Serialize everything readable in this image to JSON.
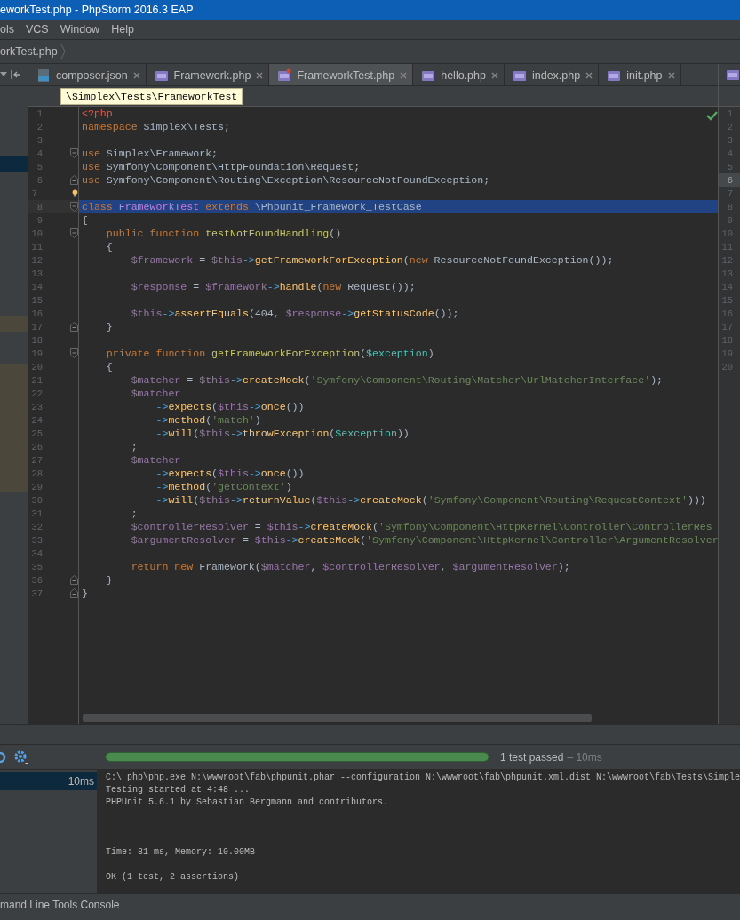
{
  "window": {
    "title": "eworkTest.php - PhpStorm 2016.3 EAP"
  },
  "menu": [
    "ols",
    "VCS",
    "Window",
    "Help"
  ],
  "breadcrumb": "orkTest.php",
  "project_panel": {
    "rows": [
      {
        "kind": "plain"
      },
      {
        "kind": "plain"
      },
      {
        "kind": "plain"
      },
      {
        "kind": "plain"
      },
      {
        "kind": "selected"
      },
      {
        "kind": "plain"
      },
      {
        "kind": "plain"
      },
      {
        "kind": "plain"
      },
      {
        "kind": "plain"
      },
      {
        "kind": "plain"
      },
      {
        "kind": "plain"
      },
      {
        "kind": "plain"
      },
      {
        "kind": "plain"
      },
      {
        "kind": "plain"
      },
      {
        "kind": "modified"
      },
      {
        "kind": "plain"
      },
      {
        "kind": "plain"
      },
      {
        "kind": "modified"
      },
      {
        "kind": "modified"
      },
      {
        "kind": "modified"
      },
      {
        "kind": "modified"
      },
      {
        "kind": "modified"
      },
      {
        "kind": "modified"
      },
      {
        "kind": "modified"
      },
      {
        "kind": "modified"
      }
    ]
  },
  "tabs": [
    {
      "label": "composer.json",
      "kind": "json",
      "selected": false
    },
    {
      "label": "Framework.php",
      "kind": "php",
      "selected": false
    },
    {
      "label": "FrameworkTest.php",
      "kind": "phptest",
      "selected": true
    },
    {
      "label": "hello.php",
      "kind": "php",
      "selected": false
    },
    {
      "label": "index.php",
      "kind": "php",
      "selected": false
    },
    {
      "label": "init.php",
      "kind": "php",
      "selected": false
    }
  ],
  "tooltip": "\\Simplex\\Tests\\FrameworkTest",
  "editor": {
    "lines": [
      {
        "number": "1",
        "selected": false,
        "fold_open": false,
        "fold_close": false,
        "bulb": false,
        "tokens": [
          {
            "kind": "tag",
            "text": "<?php"
          }
        ]
      },
      {
        "number": "2",
        "selected": false,
        "fold_open": false,
        "fold_close": false,
        "bulb": false,
        "tokens": [
          {
            "kind": "kw",
            "text": "namespace"
          },
          {
            "kind": "plain",
            "text": " Simplex\\Tests;"
          }
        ]
      },
      {
        "number": "3",
        "selected": false,
        "fold_open": false,
        "fold_close": false,
        "bulb": false
      },
      {
        "number": "4",
        "selected": false,
        "fold_open": true,
        "fold_close": false,
        "bulb": false,
        "tokens": [
          {
            "kind": "kw",
            "text": "use"
          },
          {
            "kind": "plain",
            "text": " Simplex\\Framework;"
          }
        ]
      },
      {
        "number": "5",
        "selected": false,
        "fold_open": false,
        "fold_close": false,
        "bulb": false,
        "tokens": [
          {
            "kind": "kw",
            "text": "use"
          },
          {
            "kind": "plain",
            "text": " Symfony\\Component\\HttpFoundation\\Request;"
          }
        ]
      },
      {
        "number": "6",
        "selected": false,
        "fold_open": false,
        "fold_close": true,
        "bulb": false,
        "tokens": [
          {
            "kind": "kw",
            "text": "use"
          },
          {
            "kind": "plain",
            "text": " Symfony\\Component\\Routing\\Exception\\ResourceNotFoundException;"
          }
        ]
      },
      {
        "number": "7",
        "selected": false,
        "fold_open": false,
        "fold_close": false,
        "bulb": true
      },
      {
        "number": "8",
        "selected": true,
        "fold_open": true,
        "fold_close": false,
        "bulb": false,
        "tokens": [
          {
            "kind": "kw",
            "text": "class "
          },
          {
            "kind": "cls",
            "text": "FrameworkTest "
          },
          {
            "kind": "kw",
            "text": "extends"
          },
          {
            "kind": "plain",
            "text": " \\Phpunit_Framework_TestCase"
          }
        ]
      },
      {
        "number": "9",
        "selected": false,
        "fold_open": false,
        "fold_close": false,
        "bulb": false,
        "tokens": [
          {
            "kind": "plain",
            "text": "{"
          }
        ]
      },
      {
        "number": "10",
        "selected": false,
        "fold_open": true,
        "fold_close": false,
        "bulb": false,
        "tokens": [
          {
            "kind": "kw",
            "text": "    public function "
          },
          {
            "kind": "fndef",
            "text": "testNotFoundHandling"
          },
          {
            "kind": "plain",
            "text": "()"
          }
        ]
      },
      {
        "number": "11",
        "selected": false,
        "fold_open": false,
        "fold_close": false,
        "bulb": false,
        "tokens": [
          {
            "kind": "plain",
            "text": "    {"
          }
        ]
      },
      {
        "number": "12",
        "selected": false,
        "fold_open": false,
        "fold_close": false,
        "bulb": false,
        "tokens": [
          {
            "kind": "var",
            "text": "        $framework"
          },
          {
            "kind": "plain",
            "text": " = "
          },
          {
            "kind": "var",
            "text": "$this"
          },
          {
            "kind": "arrow",
            "text": "->"
          },
          {
            "kind": "call",
            "text": "getFrameworkForException"
          },
          {
            "kind": "plain",
            "text": "("
          },
          {
            "kind": "kw",
            "text": "new"
          },
          {
            "kind": "plain",
            "text": " ResourceNotFoundException());"
          }
        ]
      },
      {
        "number": "13",
        "selected": false,
        "fold_open": false,
        "fold_close": false,
        "bulb": false
      },
      {
        "number": "14",
        "selected": false,
        "fold_open": false,
        "fold_close": false,
        "bulb": false,
        "tokens": [
          {
            "kind": "var",
            "text": "        $response"
          },
          {
            "kind": "plain",
            "text": " = "
          },
          {
            "kind": "var",
            "text": "$framework"
          },
          {
            "kind": "arrow",
            "text": "->"
          },
          {
            "kind": "call",
            "text": "handle"
          },
          {
            "kind": "plain",
            "text": "("
          },
          {
            "kind": "kw",
            "text": "new"
          },
          {
            "kind": "plain",
            "text": " Request());"
          }
        ]
      },
      {
        "number": "15",
        "selected": false,
        "fold_open": false,
        "fold_close": false,
        "bulb": false
      },
      {
        "number": "16",
        "selected": false,
        "fold_open": false,
        "fold_close": false,
        "bulb": false,
        "tokens": [
          {
            "kind": "var",
            "text": "        $this"
          },
          {
            "kind": "arrow",
            "text": "->"
          },
          {
            "kind": "call",
            "text": "assertEquals"
          },
          {
            "kind": "plain",
            "text": "(404, "
          },
          {
            "kind": "var",
            "text": "$response"
          },
          {
            "kind": "arrow",
            "text": "->"
          },
          {
            "kind": "call",
            "text": "getStatusCode"
          },
          {
            "kind": "plain",
            "text": "());"
          }
        ]
      },
      {
        "number": "17",
        "selected": false,
        "fold_open": false,
        "fold_close": true,
        "bulb": false,
        "tokens": [
          {
            "kind": "plain",
            "text": "    }"
          }
        ]
      },
      {
        "number": "18",
        "selected": false,
        "fold_open": false,
        "fold_close": false,
        "bulb": false
      },
      {
        "number": "19",
        "selected": false,
        "fold_open": true,
        "fold_close": false,
        "bulb": false,
        "tokens": [
          {
            "kind": "kw",
            "text": "    private function "
          },
          {
            "kind": "fndef",
            "text": "getFrameworkForException"
          },
          {
            "kind": "plain",
            "text": "("
          },
          {
            "kind": "param",
            "text": "$exception"
          },
          {
            "kind": "plain",
            "text": ")"
          }
        ]
      },
      {
        "number": "20",
        "selected": false,
        "fold_open": false,
        "fold_close": false,
        "bulb": false,
        "tokens": [
          {
            "kind": "plain",
            "text": "    {"
          }
        ]
      },
      {
        "number": "21",
        "selected": false,
        "fold_open": false,
        "fold_close": false,
        "bulb": false,
        "tokens": [
          {
            "kind": "var",
            "text": "        $matcher"
          },
          {
            "kind": "plain",
            "text": " = "
          },
          {
            "kind": "var",
            "text": "$this"
          },
          {
            "kind": "arrow",
            "text": "->"
          },
          {
            "kind": "call",
            "text": "createMock"
          },
          {
            "kind": "plain",
            "text": "("
          },
          {
            "kind": "str",
            "text": "'Symfony\\Component\\Routing\\Matcher\\UrlMatcherInterface'"
          },
          {
            "kind": "plain",
            "text": ");"
          }
        ]
      },
      {
        "number": "22",
        "selected": false,
        "fold_open": false,
        "fold_close": false,
        "bulb": false,
        "tokens": [
          {
            "kind": "var",
            "text": "        $matcher"
          }
        ]
      },
      {
        "number": "23",
        "selected": false,
        "fold_open": false,
        "fold_close": false,
        "bulb": false,
        "tokens": [
          {
            "kind": "arrow",
            "text": "            ->"
          },
          {
            "kind": "call",
            "text": "expects"
          },
          {
            "kind": "plain",
            "text": "("
          },
          {
            "kind": "var",
            "text": "$this"
          },
          {
            "kind": "arrow",
            "text": "->"
          },
          {
            "kind": "call",
            "text": "once"
          },
          {
            "kind": "plain",
            "text": "())"
          }
        ]
      },
      {
        "number": "24",
        "selected": false,
        "fold_open": false,
        "fold_close": false,
        "bulb": false,
        "tokens": [
          {
            "kind": "arrow",
            "text": "            ->"
          },
          {
            "kind": "call",
            "text": "method"
          },
          {
            "kind": "plain",
            "text": "("
          },
          {
            "kind": "str",
            "text": "'match'"
          },
          {
            "kind": "plain",
            "text": ")"
          }
        ]
      },
      {
        "number": "25",
        "selected": false,
        "fold_open": false,
        "fold_close": false,
        "bulb": false,
        "tokens": [
          {
            "kind": "arrow",
            "text": "            ->"
          },
          {
            "kind": "call",
            "text": "will"
          },
          {
            "kind": "plain",
            "text": "("
          },
          {
            "kind": "var",
            "text": "$this"
          },
          {
            "kind": "arrow",
            "text": "->"
          },
          {
            "kind": "call",
            "text": "throwException"
          },
          {
            "kind": "plain",
            "text": "("
          },
          {
            "kind": "param",
            "text": "$exception"
          },
          {
            "kind": "plain",
            "text": "))"
          }
        ]
      },
      {
        "number": "26",
        "selected": false,
        "fold_open": false,
        "fold_close": false,
        "bulb": false,
        "tokens": [
          {
            "kind": "plain",
            "text": "        ;"
          }
        ]
      },
      {
        "number": "27",
        "selected": false,
        "fold_open": false,
        "fold_close": false,
        "bulb": false,
        "tokens": [
          {
            "kind": "var",
            "text": "        $matcher"
          }
        ]
      },
      {
        "number": "28",
        "selected": false,
        "fold_open": false,
        "fold_close": false,
        "bulb": false,
        "tokens": [
          {
            "kind": "arrow",
            "text": "            ->"
          },
          {
            "kind": "call",
            "text": "expects"
          },
          {
            "kind": "plain",
            "text": "("
          },
          {
            "kind": "var",
            "text": "$this"
          },
          {
            "kind": "arrow",
            "text": "->"
          },
          {
            "kind": "call",
            "text": "once"
          },
          {
            "kind": "plain",
            "text": "())"
          }
        ]
      },
      {
        "number": "29",
        "selected": false,
        "fold_open": false,
        "fold_close": false,
        "bulb": false,
        "tokens": [
          {
            "kind": "arrow",
            "text": "            ->"
          },
          {
            "kind": "call",
            "text": "method"
          },
          {
            "kind": "plain",
            "text": "("
          },
          {
            "kind": "str",
            "text": "'getContext'"
          },
          {
            "kind": "plain",
            "text": ")"
          }
        ]
      },
      {
        "number": "30",
        "selected": false,
        "fold_open": false,
        "fold_close": false,
        "bulb": false,
        "tokens": [
          {
            "kind": "arrow",
            "text": "            ->"
          },
          {
            "kind": "call",
            "text": "will"
          },
          {
            "kind": "plain",
            "text": "("
          },
          {
            "kind": "var",
            "text": "$this"
          },
          {
            "kind": "arrow",
            "text": "->"
          },
          {
            "kind": "call",
            "text": "returnValue"
          },
          {
            "kind": "plain",
            "text": "("
          },
          {
            "kind": "var",
            "text": "$this"
          },
          {
            "kind": "arrow",
            "text": "->"
          },
          {
            "kind": "call",
            "text": "createMock"
          },
          {
            "kind": "plain",
            "text": "("
          },
          {
            "kind": "str",
            "text": "'Symfony\\Component\\Routing\\RequestContext'"
          },
          {
            "kind": "plain",
            "text": ")))"
          }
        ]
      },
      {
        "number": "31",
        "selected": false,
        "fold_open": false,
        "fold_close": false,
        "bulb": false,
        "tokens": [
          {
            "kind": "plain",
            "text": "        ;"
          }
        ]
      },
      {
        "number": "32",
        "selected": false,
        "fold_open": false,
        "fold_close": false,
        "bulb": false,
        "tokens": [
          {
            "kind": "var",
            "text": "        $controllerResolver"
          },
          {
            "kind": "plain",
            "text": " = "
          },
          {
            "kind": "var",
            "text": "$this"
          },
          {
            "kind": "arrow",
            "text": "->"
          },
          {
            "kind": "call",
            "text": "createMock"
          },
          {
            "kind": "plain",
            "text": "("
          },
          {
            "kind": "str",
            "text": "'Symfony\\Component\\HttpKernel\\Controller\\ControllerRes"
          }
        ]
      },
      {
        "number": "33",
        "selected": false,
        "fold_open": false,
        "fold_close": false,
        "bulb": false,
        "tokens": [
          {
            "kind": "var",
            "text": "        $argumentResolver"
          },
          {
            "kind": "plain",
            "text": " = "
          },
          {
            "kind": "var",
            "text": "$this"
          },
          {
            "kind": "arrow",
            "text": "->"
          },
          {
            "kind": "call",
            "text": "createMock"
          },
          {
            "kind": "plain",
            "text": "("
          },
          {
            "kind": "str",
            "text": "'Symfony\\Component\\HttpKernel\\Controller\\ArgumentResolver"
          }
        ]
      },
      {
        "number": "34",
        "selected": false,
        "fold_open": false,
        "fold_close": false,
        "bulb": false
      },
      {
        "number": "35",
        "selected": false,
        "fold_open": false,
        "fold_close": false,
        "bulb": false,
        "tokens": [
          {
            "kind": "kw",
            "text": "        return new"
          },
          {
            "kind": "plain",
            "text": " Framework("
          },
          {
            "kind": "var",
            "text": "$matcher"
          },
          {
            "kind": "plain",
            "text": ", "
          },
          {
            "kind": "var",
            "text": "$controllerResolver"
          },
          {
            "kind": "plain",
            "text": ", "
          },
          {
            "kind": "var",
            "text": "$argumentResolver"
          },
          {
            "kind": "plain",
            "text": ");"
          }
        ]
      },
      {
        "number": "36",
        "selected": false,
        "fold_open": false,
        "fold_close": true,
        "bulb": false,
        "tokens": [
          {
            "kind": "plain",
            "text": "    }"
          }
        ]
      },
      {
        "number": "37",
        "selected": false,
        "fold_open": false,
        "fold_close": true,
        "bulb": false,
        "tokens": [
          {
            "kind": "plain",
            "text": "}"
          }
        ]
      }
    ]
  },
  "split_view": {
    "line_numbers": [
      {
        "number": "1",
        "current": false
      },
      {
        "number": "2",
        "current": false
      },
      {
        "number": "3",
        "current": false
      },
      {
        "number": "4",
        "current": false
      },
      {
        "number": "5",
        "current": false
      },
      {
        "number": "6",
        "current": true
      },
      {
        "number": "7",
        "current": false
      },
      {
        "number": "8",
        "current": false
      },
      {
        "number": "9",
        "current": false
      },
      {
        "number": "10",
        "current": false
      },
      {
        "number": "11",
        "current": false
      },
      {
        "number": "12",
        "current": false
      },
      {
        "number": "13",
        "current": false
      },
      {
        "number": "14",
        "current": false
      },
      {
        "number": "15",
        "current": false
      },
      {
        "number": "16",
        "current": false
      },
      {
        "number": "17",
        "current": false
      },
      {
        "number": "18",
        "current": false
      },
      {
        "number": "19",
        "current": false
      },
      {
        "number": "20",
        "current": false
      }
    ]
  },
  "run_panel": {
    "progress": {
      "level": 1
    },
    "status": "1 test passed",
    "duration": "– 10ms",
    "test_tree": [
      {
        "time": "10ms",
        "selected": true
      }
    ],
    "console": [
      [
        "C:\\_php\\php.exe N:\\wwwroot\\fab\\phpunit.phar --configuration N:\\wwwroot\\fab\\phpunit.xml.dist N:\\wwwroot\\fab\\Tests\\Simple",
        "Testing started at 4:48 ...",
        "PHPUnit 5.6.1 by Sebastian Bergmann and contributors."
      ],
      [
        "Time: 81 ms, Memory: 10.00MB"
      ],
      [
        "OK (1 test, 2 assertions)"
      ]
    ]
  },
  "status_bar": "mand Line Tools Console"
}
